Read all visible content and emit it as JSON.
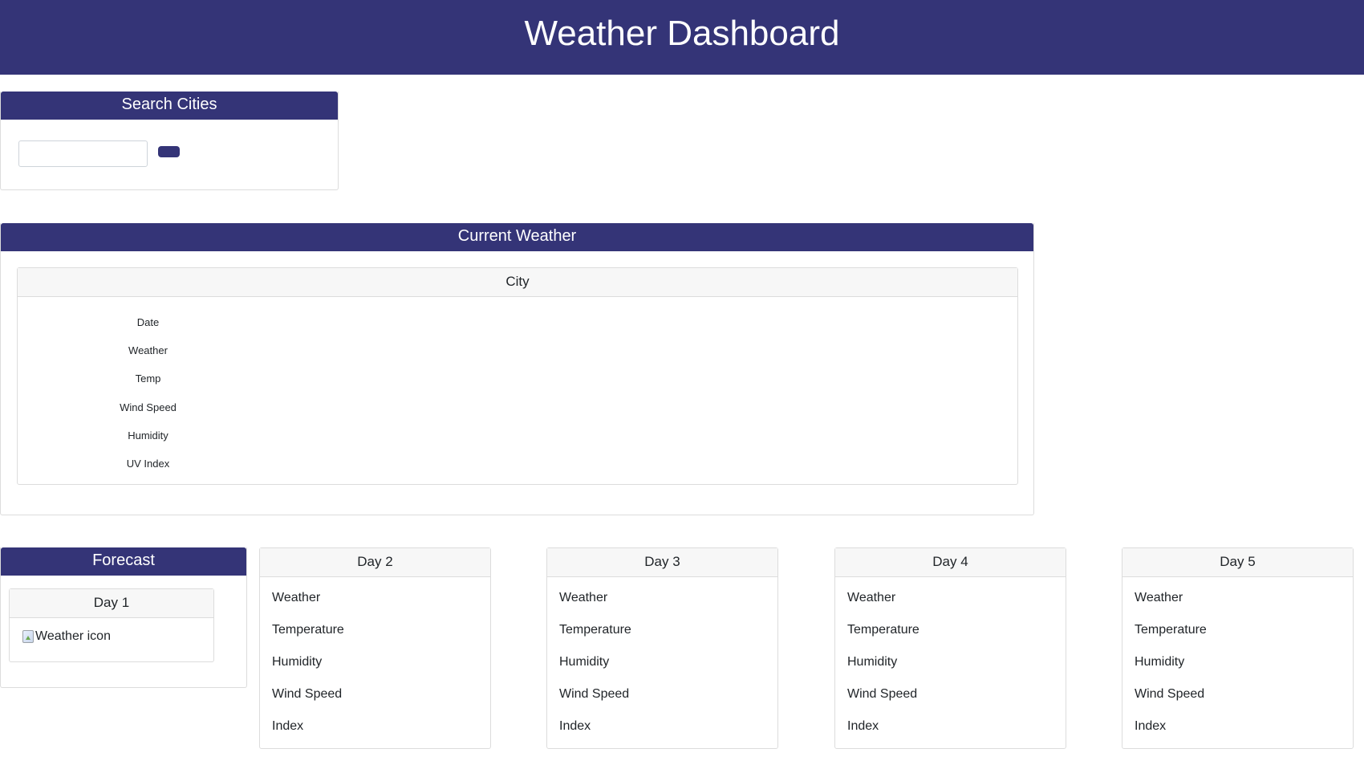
{
  "header": {
    "title": "Weather Dashboard"
  },
  "search": {
    "title": "Search Cities",
    "input_value": "",
    "placeholder": "",
    "button_label": ""
  },
  "current": {
    "title": "Current Weather",
    "city": "City",
    "fields": [
      "Date",
      "Weather",
      "Temp",
      "Wind Speed",
      "Humidity",
      "UV Index"
    ]
  },
  "forecast": {
    "title": "Forecast",
    "day1": {
      "label": "Day 1",
      "icon_alt": "Weather icon"
    },
    "days": [
      {
        "label": "Day 2",
        "fields": [
          "Weather",
          "Temperature",
          "Humidity",
          "Wind Speed",
          "Index"
        ]
      },
      {
        "label": "Day 3",
        "fields": [
          "Weather",
          "Temperature",
          "Humidity",
          "Wind Speed",
          "Index"
        ]
      },
      {
        "label": "Day 4",
        "fields": [
          "Weather",
          "Temperature",
          "Humidity",
          "Wind Speed",
          "Index"
        ]
      },
      {
        "label": "Day 5",
        "fields": [
          "Weather",
          "Temperature",
          "Humidity",
          "Wind Speed",
          "Index"
        ]
      }
    ]
  },
  "colors": {
    "brand": "#343477",
    "card_header_bg": "#f7f7f7",
    "border": "#dcdcdc"
  }
}
